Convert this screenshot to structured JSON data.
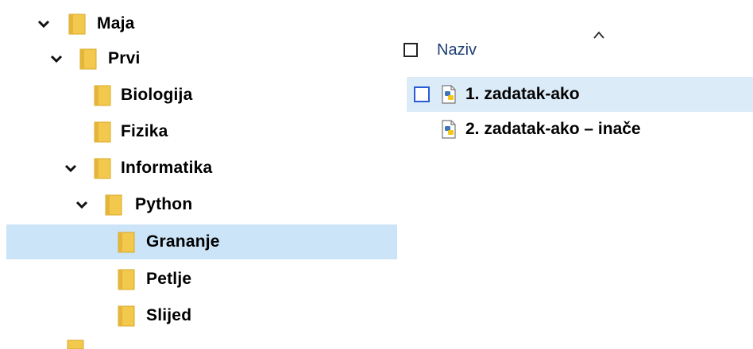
{
  "tree": {
    "items": [
      {
        "label": "Maja",
        "expanded": true
      },
      {
        "label": "Prvi",
        "expanded": true
      },
      {
        "label": "Biologija"
      },
      {
        "label": "Fizika"
      },
      {
        "label": "Informatika",
        "expanded": true
      },
      {
        "label": "Python",
        "expanded": true
      },
      {
        "label": "Grananje",
        "selected": true
      },
      {
        "label": "Petlje"
      },
      {
        "label": "Slijed"
      }
    ]
  },
  "list": {
    "column_header": "Naziv",
    "files": [
      {
        "name": "1. zadatak-ako",
        "icon": "python-file-icon"
      },
      {
        "name": "2. zadatak-ako – inače",
        "icon": "python-file-icon"
      }
    ]
  },
  "colors": {
    "folder": "#f2c94c",
    "selected_bg": "#cce4f7",
    "hover_bg": "#dcebf8",
    "header_text": "#1f3f73",
    "checkbox_blue": "#2a5bd7"
  }
}
